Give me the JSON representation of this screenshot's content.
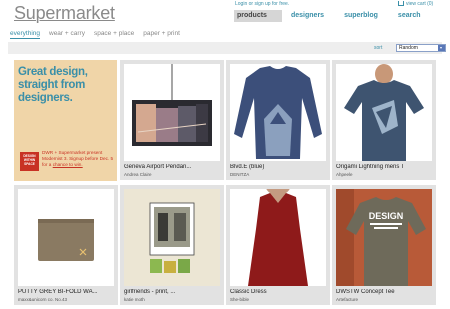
{
  "header": {
    "logo": "Supermarket",
    "login": "Login or sign up for free.",
    "cart": "view cart (0)",
    "nav": [
      {
        "label": "products",
        "active": true
      },
      {
        "label": "designers",
        "active": false
      },
      {
        "label": "superblog",
        "active": false
      },
      {
        "label": "search",
        "active": false
      }
    ]
  },
  "categories": [
    {
      "label": "everything",
      "active": true
    },
    {
      "label": "wear + carry",
      "active": false
    },
    {
      "label": "space + place",
      "active": false
    },
    {
      "label": "paper + print",
      "active": false
    }
  ],
  "sort": {
    "label": "sort",
    "selected": "Random"
  },
  "promo": {
    "headline": "Great design, straight from designers.",
    "badge": "DESIGN WITHIN SPACE",
    "text_pre": "DWR + Supermarket present Modernist 3. Signup before Dec. 5 for a",
    "text_link": "chance to win."
  },
  "products": [
    {
      "title": "Geneva Airport Pendan...",
      "designer": "Andrea Claire"
    },
    {
      "title": "Blvd.E (blue)",
      "designer": "DENITZA"
    },
    {
      "title": "Origami Lightning mens T",
      "designer": "Ahpeele"
    },
    {
      "title": "PUTTY GREY BI-FOLD WA...",
      "designer": "maxx&unicorn co. No.43"
    },
    {
      "title": "girlfriends - print, ...",
      "designer": "katie moth"
    },
    {
      "title": "Classic Dress",
      "designer": "She-bible"
    },
    {
      "title": "DWSTW Concept Tee",
      "designer": "Artefacture"
    }
  ],
  "tee_print": "DESIGN",
  "colors": {
    "accent": "#3a8fa8",
    "promo_bg": "#f0d5a8",
    "promo_red": "#c83224",
    "card_bg": "#e2e2e2"
  }
}
